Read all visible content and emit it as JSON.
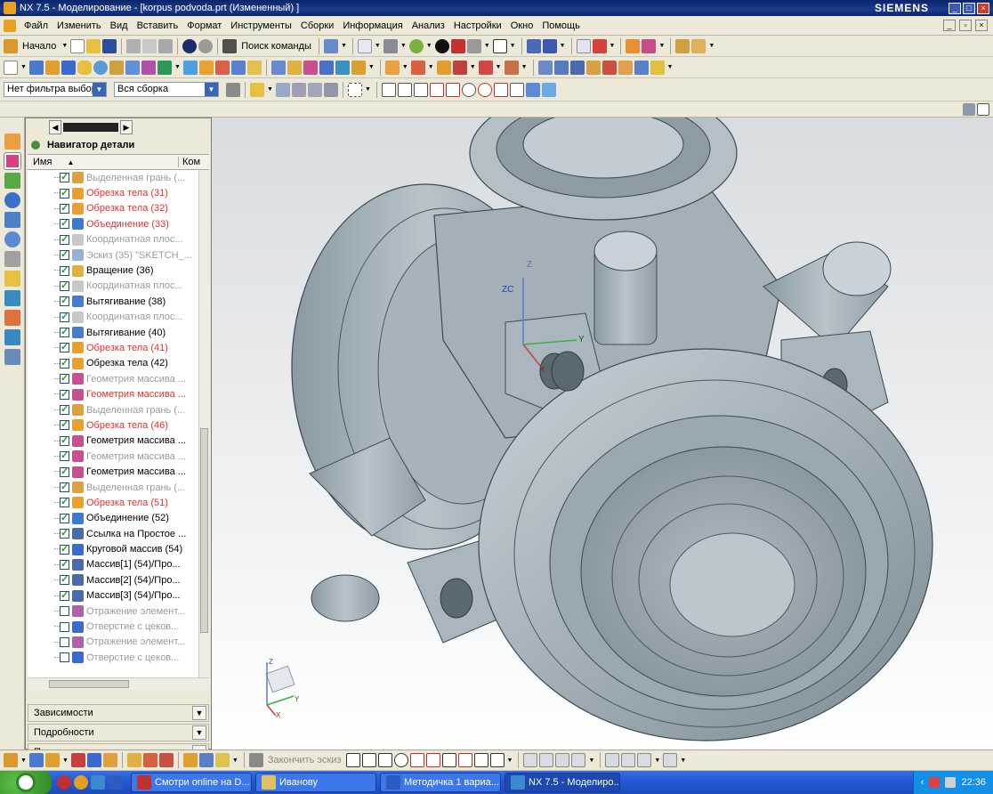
{
  "window": {
    "title": "NX 7.5 - Моделирование - [korpus podvoda.prt (Измененный) ]",
    "brand": "SIEMENS"
  },
  "menu": [
    "Файл",
    "Изменить",
    "Вид",
    "Вставить",
    "Формат",
    "Инструменты",
    "Сборки",
    "Информация",
    "Анализ",
    "Настройки",
    "Окно",
    "Помощь"
  ],
  "toolbar": {
    "start_label": "Начало",
    "command_search_label": "Поиск команды"
  },
  "selection": {
    "filter_value": "Нет фильтра выбор",
    "scope_value": "Вся сборка"
  },
  "navigator": {
    "title": "Навигатор детали",
    "columns": [
      "Имя",
      "Ком"
    ],
    "items": [
      {
        "label": "Выделенная грань (...",
        "color": "gray",
        "checked": true
      },
      {
        "label": "Обрезка тела (31)",
        "color": "red",
        "checked": true
      },
      {
        "label": "Обрезка тела (32)",
        "color": "red",
        "checked": true
      },
      {
        "label": "Объединение (33)",
        "color": "red",
        "checked": true
      },
      {
        "label": "Координатная плос...",
        "color": "gray",
        "checked": true
      },
      {
        "label": "Эскиз (35) \"SKETCH_...",
        "color": "gray",
        "checked": true
      },
      {
        "label": "Вращение (36)",
        "color": "blk",
        "checked": true
      },
      {
        "label": "Координатная плос...",
        "color": "gray",
        "checked": true
      },
      {
        "label": "Вытягивание (38)",
        "color": "blk",
        "checked": true
      },
      {
        "label": "Координатная плос...",
        "color": "gray",
        "checked": true
      },
      {
        "label": "Вытягивание (40)",
        "color": "blk",
        "checked": true
      },
      {
        "label": "Обрезка тела (41)",
        "color": "red",
        "checked": true
      },
      {
        "label": "Обрезка тела (42)",
        "color": "blk",
        "checked": true
      },
      {
        "label": "Геометрия массива ...",
        "color": "gray",
        "checked": true
      },
      {
        "label": "Геометрия массива ...",
        "color": "red",
        "checked": true
      },
      {
        "label": "Выделенная грань (...",
        "color": "gray",
        "checked": true
      },
      {
        "label": "Обрезка тела (46)",
        "color": "red",
        "checked": true
      },
      {
        "label": "Геометрия массива ...",
        "color": "blk",
        "checked": true
      },
      {
        "label": "Геометрия массива ...",
        "color": "gray",
        "checked": true
      },
      {
        "label": "Геометрия массива ...",
        "color": "blk",
        "checked": true
      },
      {
        "label": "Выделенная грань (...",
        "color": "gray",
        "checked": true
      },
      {
        "label": "Обрезка тела (51)",
        "color": "red",
        "checked": true
      },
      {
        "label": "Объединение (52)",
        "color": "blk",
        "checked": true
      },
      {
        "label": "Ссылка на Простое ...",
        "color": "blk",
        "checked": true
      },
      {
        "label": "Круговой массив (54)",
        "color": "blk",
        "checked": true
      },
      {
        "label": "Массив[1] (54)/Про...",
        "color": "blk",
        "checked": true
      },
      {
        "label": "Массив[2] (54)/Про...",
        "color": "blk",
        "checked": true
      },
      {
        "label": "Массив[3] (54)/Про...",
        "color": "blk",
        "checked": true
      },
      {
        "label": "Отражение элемент...",
        "color": "gray",
        "checked": false
      },
      {
        "label": "Отверстие с цеков...",
        "color": "gray",
        "checked": false
      },
      {
        "label": "Отражение элемент...",
        "color": "gray",
        "checked": false
      },
      {
        "label": "Отверстие с цеков...",
        "color": "gray",
        "checked": false
      }
    ],
    "sections": [
      "Зависимости",
      "Подробности",
      "Просмотр"
    ]
  },
  "viewport": {
    "axis_labels": [
      "Z",
      "ZC",
      "Y",
      "X"
    ],
    "triad_labels": [
      "Z",
      "Y",
      "X"
    ]
  },
  "sketch_toolbar": {
    "finish_label": "Закончить эскиз"
  },
  "taskbar": {
    "tasks": [
      {
        "label": "Смотри online на D...",
        "active": false
      },
      {
        "label": "Иванову",
        "active": false
      },
      {
        "label": "Методичка 1 вариа...",
        "active": false
      },
      {
        "label": "NX 7.5 - Моделиро...",
        "active": true
      }
    ],
    "clock": "22:36"
  },
  "colors": {
    "model": "#a9b5bc",
    "titlebar": "#0a246a",
    "red_item": "#e03030"
  }
}
